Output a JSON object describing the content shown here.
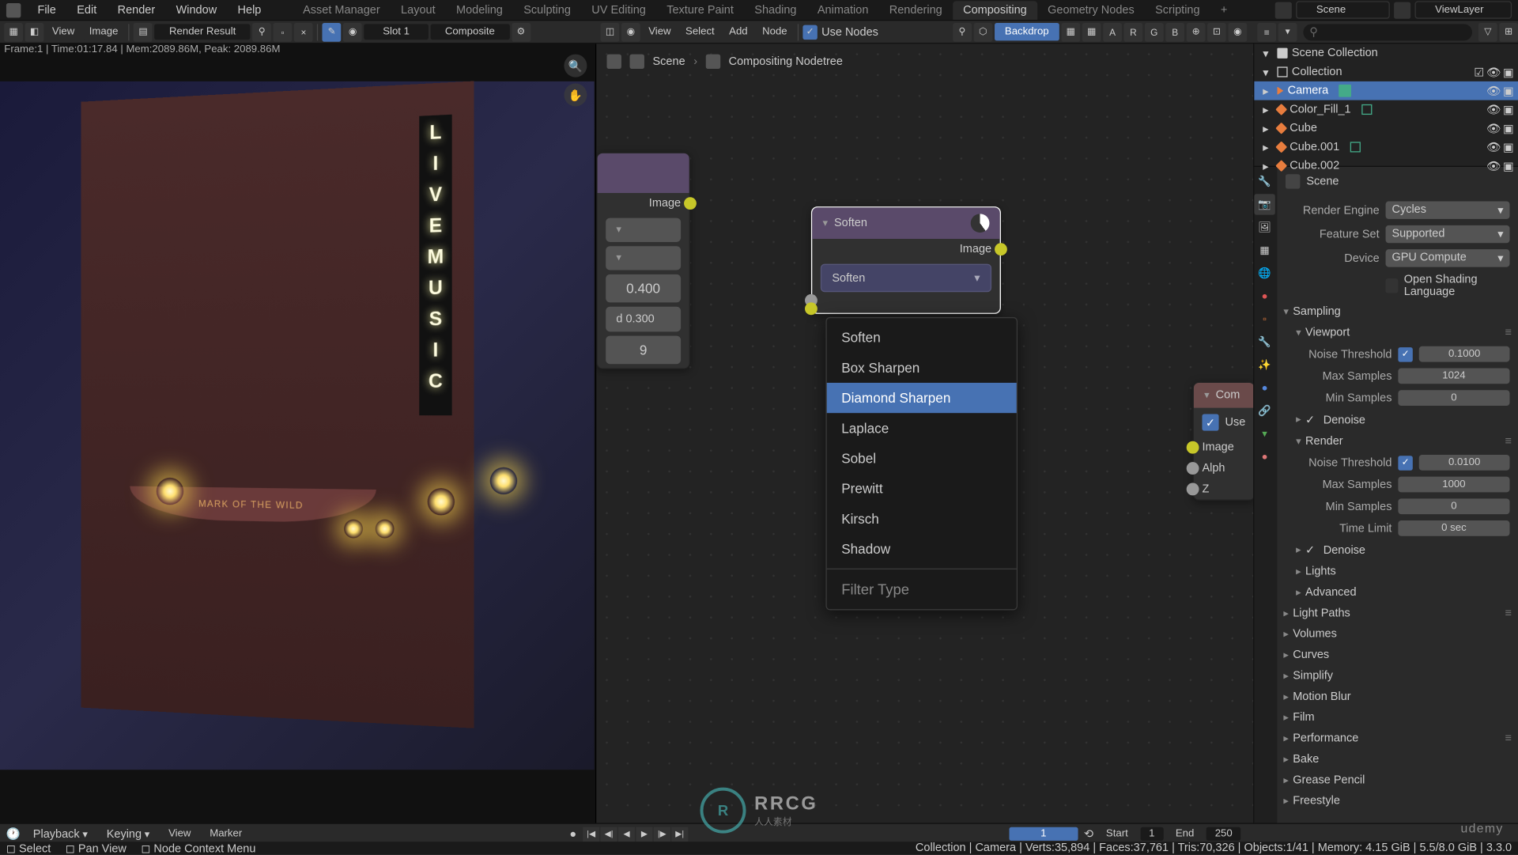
{
  "topmenu": [
    "File",
    "Edit",
    "Render",
    "Window",
    "Help"
  ],
  "workspaces": [
    "Asset Manager",
    "Layout",
    "Modeling",
    "Sculpting",
    "UV Editing",
    "Texture Paint",
    "Shading",
    "Animation",
    "Rendering",
    "Compositing",
    "Geometry Nodes",
    "Scripting"
  ],
  "active_ws": "Compositing",
  "scene_field": "Scene",
  "layer_field": "ViewLayer",
  "img_header": {
    "view": "View",
    "image": "Image",
    "slot": "Slot 1",
    "comp": "Composite",
    "result": "Render Result"
  },
  "node_header": {
    "view": "View",
    "select": "Select",
    "add": "Add",
    "node": "Node",
    "usenodes": "Use Nodes",
    "backdrop": "Backdrop"
  },
  "img_status": "Frame:1 | Time:01:17.84 | Mem:2089.86M, Peak: 2089.86M",
  "breadcrumb": {
    "scene": "Scene",
    "tree": "Compositing Nodetree"
  },
  "awning": "MARK OF THE WILD",
  "neon": "LIVEMUSIC",
  "node_left": {
    "out": "Image",
    "v1": "0.400",
    "v2": "d   0.300",
    "v3": "9"
  },
  "node_filter": {
    "title": "Soften",
    "out": "Image",
    "sel": "Soften"
  },
  "dropdown": {
    "items": [
      "Soften",
      "Box Sharpen",
      "Diamond Sharpen",
      "Laplace",
      "Sobel",
      "Prewitt",
      "Kirsch",
      "Shadow"
    ],
    "hl": "Diamond Sharpen",
    "title": "Filter Type"
  },
  "node_comp": {
    "title": "Com",
    "use": "Use",
    "img": "Image",
    "alpha": "Alph",
    "z": "Z"
  },
  "outliner": {
    "root": "Scene Collection",
    "coll": "Collection",
    "items": [
      "Camera",
      "Color_Fill_1",
      "Cube",
      "Cube.001",
      "Cube.002"
    ]
  },
  "props_scene": "Scene",
  "render": {
    "engine_l": "Render Engine",
    "engine": "Cycles",
    "fs_l": "Feature Set",
    "fs": "Supported",
    "dev_l": "Device",
    "dev": "GPU Compute",
    "osl": "Open Shading Language"
  },
  "sampling": {
    "hdr": "Sampling",
    "vp": "Viewport",
    "rn": "Render",
    "nt_l": "Noise Threshold",
    "nt_vp": "0.1000",
    "ms_l": "Max Samples",
    "ms_vp": "1024",
    "min_l": "Min Samples",
    "min_vp": "0",
    "nt_rn": "0.0100",
    "ms_rn": "1000",
    "min_rn": "0",
    "tl_l": "Time Limit",
    "tl": "0 sec",
    "dn": "Denoise",
    "li": "Lights",
    "adv": "Advanced"
  },
  "sections": [
    "Light Paths",
    "Volumes",
    "Curves",
    "Simplify",
    "Motion Blur",
    "Film",
    "Performance",
    "Bake",
    "Grease Pencil",
    "Freestyle"
  ],
  "timeline": {
    "pb": "Playback",
    "key": "Keying",
    "view": "View",
    "mark": "Marker",
    "cur": "1",
    "start_l": "Start",
    "start": "1",
    "end_l": "End",
    "end": "250"
  },
  "status": {
    "sel": "Select",
    "pan": "Pan View",
    "ctx": "Node Context Menu",
    "r": "Collection | Camera | Verts:35,894 | Faces:37,761 | Tris:70,326 | Objects:1/41 | Memory: 4.15 GiB | 5.5/8.0 GiB | 3.3.0"
  },
  "wm": {
    "big": "RRCG",
    "sm": "人人素材"
  },
  "udemy": "udemy"
}
